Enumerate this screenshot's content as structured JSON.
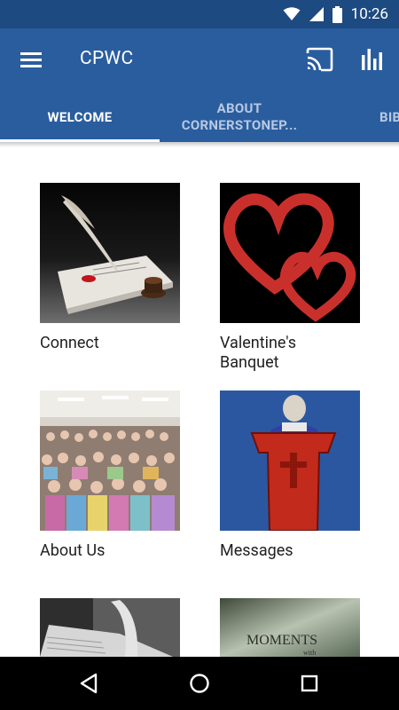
{
  "status": {
    "time": "10:26"
  },
  "app": {
    "title": "CPWC"
  },
  "tabs": [
    {
      "label": "WELCOME",
      "active": true
    },
    {
      "label": "ABOUT CORNERSTONEP...",
      "active": false
    },
    {
      "label": "BIB",
      "active": false
    }
  ],
  "tiles": [
    {
      "label": "Connect"
    },
    {
      "label": "Valentine's Banquet"
    },
    {
      "label": "About Us"
    },
    {
      "label": "Messages"
    },
    {
      "label": ""
    },
    {
      "label": ""
    }
  ],
  "tile_image_text": {
    "moments": "MOMENTS",
    "moments_sub": "with"
  },
  "colors": {
    "status_bar": "#1d4a80",
    "app_bar": "#2a5d9e",
    "tab_active": "#ffffff",
    "tab_inactive": "#b7c9e2",
    "text_primary": "#212121",
    "nav_bar": "#000000"
  },
  "icons": [
    "wifi-icon",
    "signal-icon",
    "battery-icon",
    "menu-icon",
    "cast-icon",
    "stats-icon",
    "back-icon",
    "home-icon",
    "recents-icon"
  ]
}
